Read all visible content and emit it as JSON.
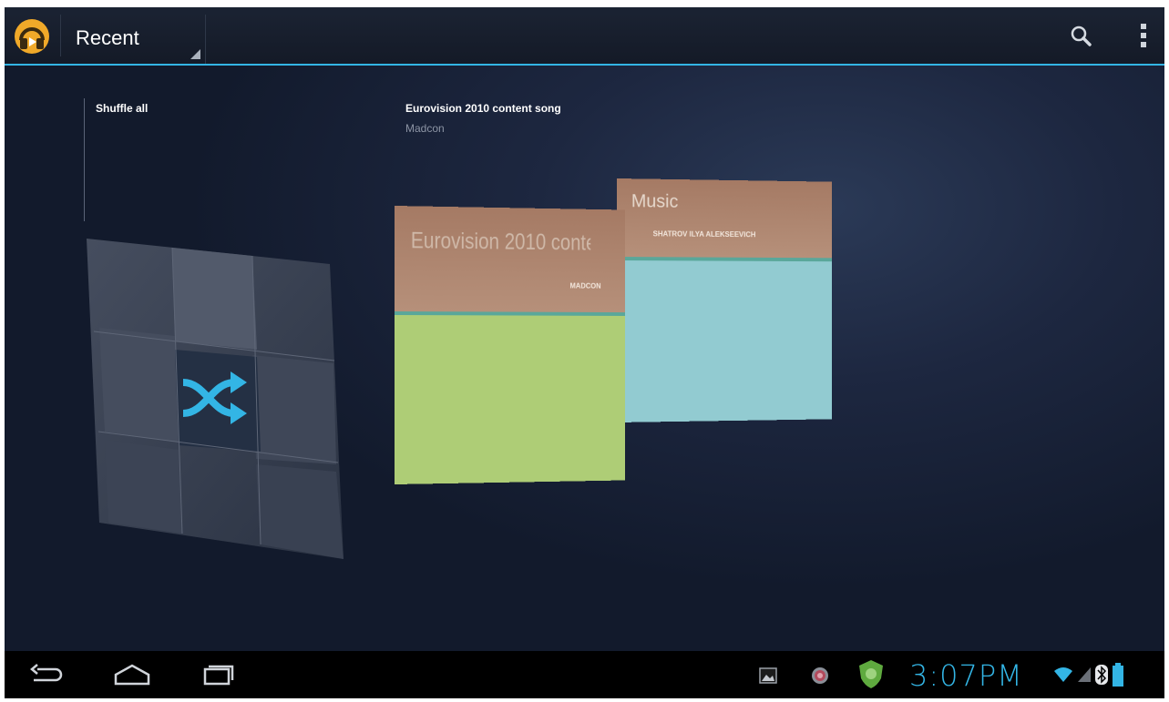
{
  "action_bar": {
    "app_icon": "headphones-icon",
    "view_selector": "Recent",
    "search_icon": "search-icon",
    "overflow_icon": "overflow-menu-icon",
    "accent_color": "#33b5e5"
  },
  "shuffle": {
    "label": "Shuffle all",
    "icon": "shuffle-icon",
    "icon_color": "#33b5e5"
  },
  "featured": {
    "title": "Eurovision 2010 content song",
    "artist": "Madcon"
  },
  "cards": [
    {
      "title": "Eurovision 2010 conte",
      "artist": "MADCON",
      "color": "#aecd76"
    },
    {
      "title": "Music",
      "artist": "SHATROV ILYA ALEKSEEVICH",
      "color": "#92cbd1"
    }
  ],
  "nav_bar": {
    "back_icon": "back-icon",
    "home_icon": "home-icon",
    "recents_icon": "recent-apps-icon"
  },
  "status_bar": {
    "time": "3:07PM",
    "icons": [
      "gallery-notification-icon",
      "app-notification-icon",
      "shield-notification-icon",
      "wifi-icon",
      "signal-icon",
      "bluetooth-icon",
      "battery-icon"
    ]
  }
}
